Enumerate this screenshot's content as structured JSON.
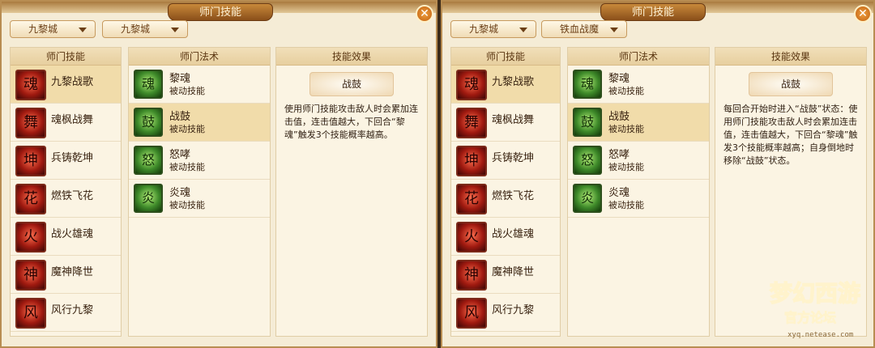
{
  "left": {
    "title": "师门技能",
    "dropdown1": "九黎城",
    "dropdown2": "九黎城",
    "headers": {
      "skills": "师门技能",
      "spells": "师门法术",
      "effect": "技能效果"
    },
    "skills": [
      "九黎战歌",
      "魂枫战舞",
      "兵铸乾坤",
      "燃铁飞花",
      "战火雄魂",
      "魔神降世",
      "风行九黎"
    ],
    "spells": [
      {
        "name": "黎魂",
        "type": "被动技能"
      },
      {
        "name": "战鼓",
        "type": "被动技能"
      },
      {
        "name": "怒哮",
        "type": "被动技能"
      },
      {
        "name": "炎魂",
        "type": "被动技能"
      }
    ],
    "effect_title": "战鼓",
    "effect_text": "使用师门技能攻击敌人时会累加连击值，连击值越大，下回合“黎魂”触发3个技能概率越高。"
  },
  "right": {
    "title": "师门技能",
    "dropdown1": "九黎城",
    "dropdown2": "铁血战魔",
    "headers": {
      "skills": "师门技能",
      "spells": "师门法术",
      "effect": "技能效果"
    },
    "skills": [
      "九黎战歌",
      "魂枫战舞",
      "兵铸乾坤",
      "燃铁飞花",
      "战火雄魂",
      "魔神降世",
      "风行九黎"
    ],
    "spells": [
      {
        "name": "黎魂",
        "type": "被动技能"
      },
      {
        "name": "战鼓",
        "type": "被动技能"
      },
      {
        "name": "怒哮",
        "type": "被动技能"
      },
      {
        "name": "炎魂",
        "type": "被动技能"
      }
    ],
    "effect_title": "战鼓",
    "effect_text": "每回合开始时进入“战鼓”状态：使用师门技能攻击敌人时会累加连击值，连击值越大，下回合“黎魂”触发3个技能概率越高；自身倒地时移除“战鼓”状态。"
  },
  "watermark": {
    "line1": "梦幻西游",
    "line2": "官方论坛",
    "url": "xyq.netease.com"
  }
}
